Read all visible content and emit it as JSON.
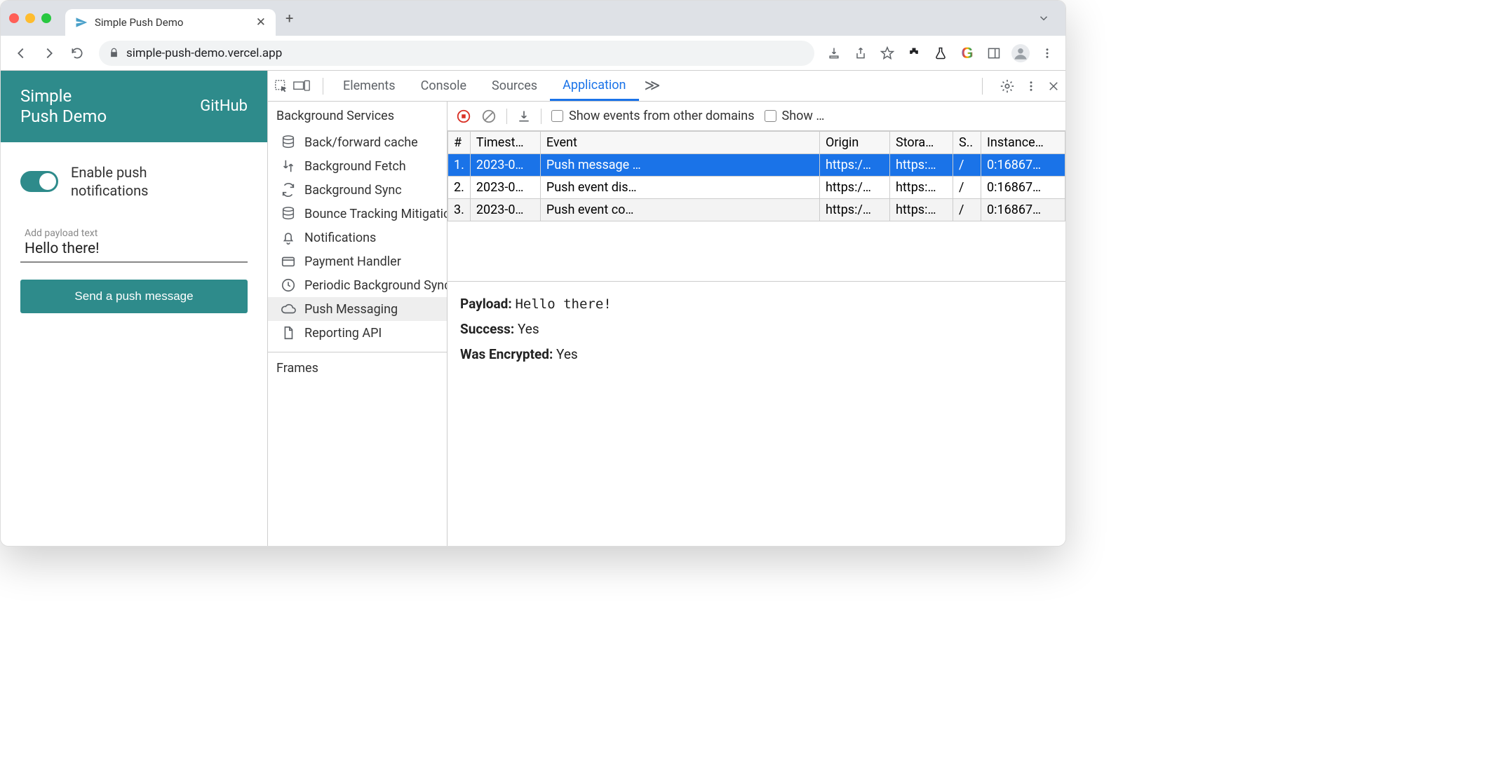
{
  "browser": {
    "tab_title": "Simple Push Demo",
    "new_tab": "+",
    "url": "simple-push-demo.vercel.app"
  },
  "page": {
    "title_line1": "Simple",
    "title_line2": "Push Demo",
    "repo_link": "GitHub",
    "toggle_label_line1": "Enable push",
    "toggle_label_line2": "notifications",
    "payload_label": "Add payload text",
    "payload_value": "Hello there!",
    "send_button": "Send a push message"
  },
  "devtools": {
    "tabs": [
      "Elements",
      "Console",
      "Sources",
      "Application"
    ],
    "active_tab": "Application",
    "overflow": "≫",
    "sidebar": {
      "section": "Background Services",
      "items": [
        "Back/forward cache",
        "Background Fetch",
        "Background Sync",
        "Bounce Tracking Mitigations",
        "Notifications",
        "Payment Handler",
        "Periodic Background Sync",
        "Push Messaging",
        "Reporting API"
      ],
      "selected": "Push Messaging",
      "section2": "Frames"
    },
    "toolbar": {
      "cb1": "Show events from other domains",
      "cb2": "Show …"
    },
    "columns": [
      "#",
      "Timest…",
      "Event",
      "Origin",
      "Stora…",
      "S..",
      "Instance…"
    ],
    "rows": [
      {
        "n": "1.",
        "ts": "2023-0…",
        "ev": "Push message …",
        "or": "https:/…",
        "st": "https:…",
        "sw": "/",
        "in": "0:16867…",
        "sel": true
      },
      {
        "n": "2.",
        "ts": "2023-0…",
        "ev": "Push event dis…",
        "or": "https:/…",
        "st": "https:…",
        "sw": "/",
        "in": "0:16867…",
        "sel": false
      },
      {
        "n": "3.",
        "ts": "2023-0…",
        "ev": "Push event co…",
        "or": "https:/…",
        "st": "https:…",
        "sw": "/",
        "in": "0:16867…",
        "sel": false
      }
    ],
    "detail": {
      "payload_k": "Payload:",
      "payload_v": "Hello there!",
      "success_k": "Success:",
      "success_v": "Yes",
      "enc_k": "Was Encrypted:",
      "enc_v": "Yes"
    }
  }
}
